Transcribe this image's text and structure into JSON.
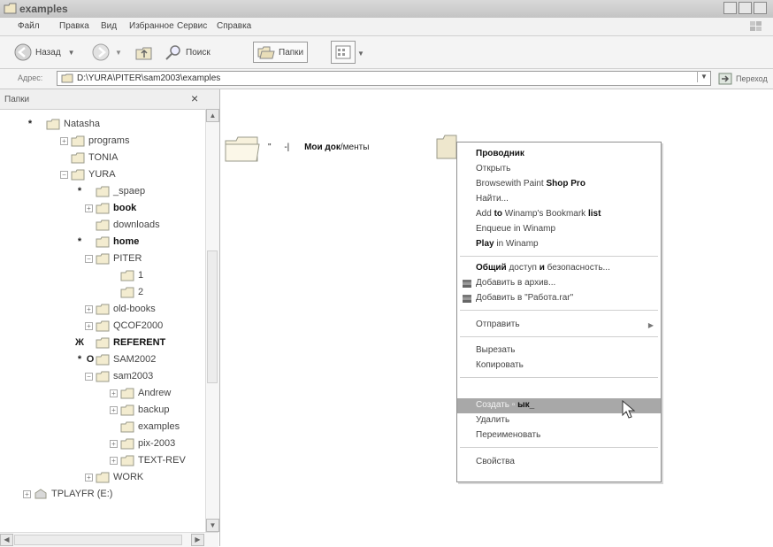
{
  "window": {
    "title": "examples"
  },
  "menubar": {
    "items": [
      "Файл",
      "Правка",
      "Вид",
      "Избранное",
      "Сервис",
      "Справка"
    ]
  },
  "toolbar": {
    "back_label": "Назад",
    "search_label": "Поиск",
    "folders_label": "Папки"
  },
  "address": {
    "label": "Адрес:",
    "path": "D:\\YURA\\PITER\\sam2003\\examples",
    "go_label": "Переход"
  },
  "folders_panel": {
    "title": "Папки",
    "close_symbol": "×",
    "tree": [
      {
        "marker": "*",
        "expander": "",
        "label": "Natasha",
        "bold": false
      },
      {
        "marker": "",
        "expander": "+",
        "label": "programs",
        "bold": false
      },
      {
        "marker": "",
        "expander": "",
        "label": "TONIA",
        "bold": false
      },
      {
        "marker": "",
        "expander": "−",
        "label": "YURA",
        "bold": false
      },
      {
        "marker": "*",
        "expander": "",
        "label": "_spaep",
        "bold": false
      },
      {
        "marker": "",
        "expander": "+",
        "label": "book",
        "bold": true
      },
      {
        "marker": "",
        "expander": "",
        "label": "downloads",
        "bold": false
      },
      {
        "marker": "*",
        "expander": "",
        "label": "home",
        "bold": true
      },
      {
        "marker": "",
        "expander": "−",
        "label": "PITER",
        "bold": false
      },
      {
        "marker": "",
        "expander": "",
        "label": "1",
        "bold": false
      },
      {
        "marker": "",
        "expander": "",
        "label": "2",
        "bold": false
      },
      {
        "marker": "",
        "expander": "+",
        "label": "old-books",
        "bold": false
      },
      {
        "marker": "",
        "expander": "+",
        "label": "QCOF2000",
        "bold": false
      },
      {
        "marker": "Ж",
        "expander": "",
        "label": "REFERENT",
        "bold": true
      },
      {
        "marker": "*",
        "expander": "O",
        "label": "SAM2002",
        "bold": false
      },
      {
        "marker": "",
        "expander": "−",
        "label": "sam2003",
        "bold": false
      },
      {
        "marker": "",
        "expander": "+",
        "label": "Andrew",
        "bold": false
      },
      {
        "marker": "",
        "expander": "+",
        "label": "backup",
        "bold": false
      },
      {
        "marker": "",
        "expander": "",
        "label": "examples",
        "bold": false
      },
      {
        "marker": "",
        "expander": "+",
        "label": "pix-2003",
        "bold": false
      },
      {
        "marker": "",
        "expander": "+",
        "label": "TEXT-REV",
        "bold": false
      },
      {
        "marker": "",
        "expander": "+",
        "label": "WORK",
        "bold": false
      },
      {
        "marker": "",
        "expander": "+",
        "label": "TPLAYFR (E:)",
        "bold": false
      }
    ]
  },
  "content": {
    "item1": {
      "prefix": "\"",
      "suffix": "-|",
      "name_bold": "Мои док",
      "name_rest": "/менты"
    }
  },
  "context_menu": {
    "items": [
      {
        "bold": "Проводник",
        "rest": ""
      },
      {
        "bold": "",
        "rest": "Открыть"
      },
      {
        "bold": "",
        "rest": "Browsewith Paint ",
        "bold2": "Shop Pro"
      },
      {
        "bold": "",
        "rest": "Найти..."
      },
      {
        "bold": "",
        "rest": "Add ",
        "bold2": "to",
        "rest2": " Winamp's Bookmark ",
        "bold3": "list"
      },
      {
        "bold": "",
        "rest": "Enqueue in Winamp"
      },
      {
        "bold": "Play",
        "rest": " in Winamp"
      },
      {
        "bold": "Общий",
        "rest": " доступ ",
        "bold2": "и",
        "rest2": " безопасность..."
      },
      {
        "bold": "",
        "rest": "Добавить в архив..."
      },
      {
        "bold": "",
        "rest": "Добавить в \"Работа.rar\""
      },
      {
        "bold": "",
        "rest": "Отправить"
      },
      {
        "bold": "",
        "rest": "Вырезать"
      },
      {
        "bold": "",
        "rest": "Копировать"
      },
      {
        "bold": "",
        "rest": "Создать ▫ ",
        "bold2": "ык_"
      },
      {
        "bold": "",
        "rest": "Удалить"
      },
      {
        "bold": "",
        "rest": "Переименовать"
      },
      {
        "bold": "",
        "rest": "Свойства"
      }
    ],
    "submenu_arrow": "▶"
  },
  "colors": {
    "highlight": "#a8a8a8",
    "folder_fill": "#f3ecd0",
    "folder_stroke": "#9a9a8a"
  },
  "icons": {
    "back": "back-arrow-icon",
    "forward": "forward-arrow-icon",
    "up": "up-folder-icon",
    "search": "magnifier-icon",
    "folders": "folders-icon",
    "views": "views-grid-icon",
    "archive": "winrar-archive-icon",
    "cursor": "mouse-pointer-icon"
  }
}
